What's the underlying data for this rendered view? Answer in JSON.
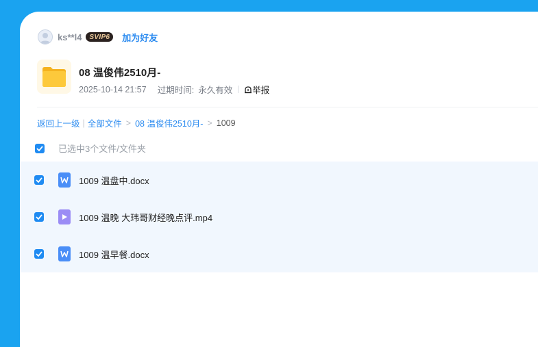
{
  "user": {
    "name": "ks**l4",
    "vip_badge": "SVIP6",
    "add_friend": "加为好友"
  },
  "share": {
    "title": "08 温俊伟2510月-",
    "date": "2025-10-14 21:57",
    "expire_label": "过期时间:",
    "expire_value": "永久有效",
    "report": "举报"
  },
  "breadcrumb": {
    "back": "返回上一级",
    "all_files": "全部文件",
    "folder": "08 温俊伟2510月-",
    "current": "1009"
  },
  "selection": {
    "text": "已选中3个文件/文件夹"
  },
  "files": [
    {
      "name": "1009 温盘中.docx",
      "type": "word",
      "checked": true
    },
    {
      "name": "1009 温晚 大玮哥财经晚点评.mp4",
      "type": "video",
      "checked": true
    },
    {
      "name": "1009 温早餐.docx",
      "type": "word",
      "checked": true
    }
  ],
  "colors": {
    "accent": "#2d8cf0",
    "background": "#1aa3f0",
    "word_icon": "#4a8ef7",
    "video_icon": "#9b8cf5",
    "folder": "#f7c02b"
  }
}
